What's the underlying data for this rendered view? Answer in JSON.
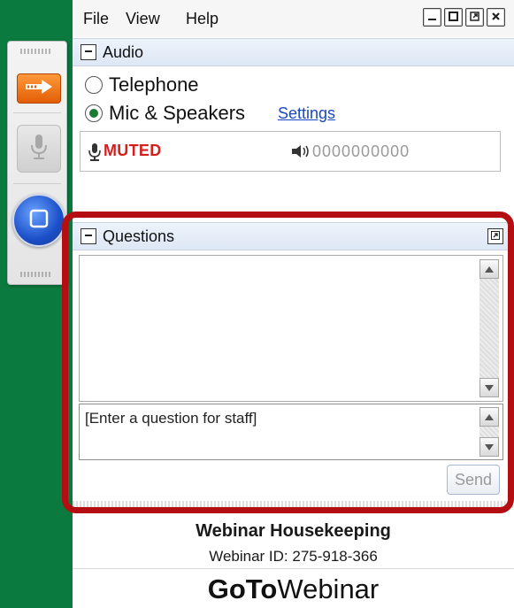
{
  "menu": {
    "file": "File",
    "view": "View",
    "help": "Help"
  },
  "audio": {
    "title": "Audio",
    "options": {
      "telephone": "Telephone",
      "mic_speakers": "Mic & Speakers"
    },
    "selected": "mic_speakers",
    "settings_link": "Settings",
    "status": "MUTED",
    "level_meter": "0000000000"
  },
  "questions": {
    "title": "Questions",
    "input_text": "[Enter a question for staff]",
    "send_label": "Send"
  },
  "footer": {
    "title": "Webinar Housekeeping",
    "webinar_id": "Webinar ID: 275-918-366",
    "brand_bold": "GoTo",
    "brand_regular": "Webinar"
  },
  "colors": {
    "background": "#0b7a3e",
    "muted_red": "#d41f1f",
    "highlight_border": "#b40d12",
    "link": "#1b47c6"
  }
}
